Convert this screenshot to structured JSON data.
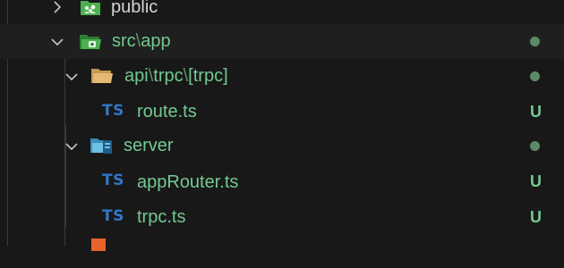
{
  "tree": {
    "public_folder": {
      "label": "public"
    },
    "src_app_folder": {
      "label_parts": [
        "src",
        "\\",
        "app"
      ]
    },
    "api_folder": {
      "label_parts": [
        "api",
        "\\",
        "trpc",
        "\\",
        "[trpc]"
      ]
    },
    "route_file": {
      "label": "route.ts",
      "icon_text": "TS",
      "status": "U"
    },
    "server_folder": {
      "label": "server"
    },
    "app_router_file": {
      "label": "appRouter.ts",
      "icon_text": "TS",
      "status": "U"
    },
    "trpc_file": {
      "label": "trpc.ts",
      "icon_text": "TS",
      "status": "U"
    }
  },
  "colors": {
    "untracked": "#73c991",
    "typescript": "#3178c6",
    "background": "#181818"
  }
}
